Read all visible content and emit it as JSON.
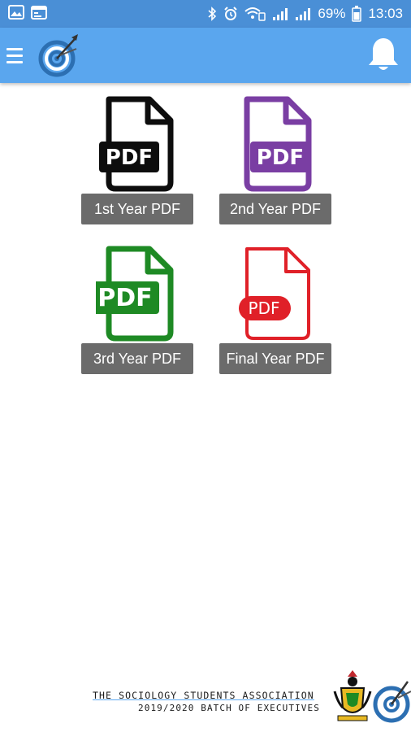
{
  "status_bar": {
    "battery": "69%",
    "time": "13:03",
    "icons": [
      "image-icon",
      "calendar-icon",
      "bluetooth-icon",
      "alarm-icon",
      "wifi-icon",
      "signal-icon",
      "signal-icon"
    ]
  },
  "app_bar": {
    "menu_icon": "hamburger-menu-icon",
    "logo_icon": "target-darts-logo-icon",
    "notification_icon": "bell-icon"
  },
  "pdf_items": [
    {
      "label": "1st Year PDF",
      "badge": "PDF",
      "color": "#0d0d0d"
    },
    {
      "label": "2nd Year PDF",
      "badge": "PDF",
      "color": "#7a3ea3"
    },
    {
      "label": "3rd Year PDF",
      "badge": "PDF",
      "color": "#1e8a24"
    },
    {
      "label": "Final Year PDF",
      "badge": "PDF",
      "color": "#e02028"
    }
  ],
  "footer": {
    "line1": "THE SOCIOLOGY STUDENTS ASSOCIATION",
    "line2": "2019/2020 BATCH OF EXECUTIVES"
  },
  "colors": {
    "status_bar": "#4a8fd6",
    "app_bar": "#5aa6ee",
    "label_bg": "#6b6b6b"
  }
}
